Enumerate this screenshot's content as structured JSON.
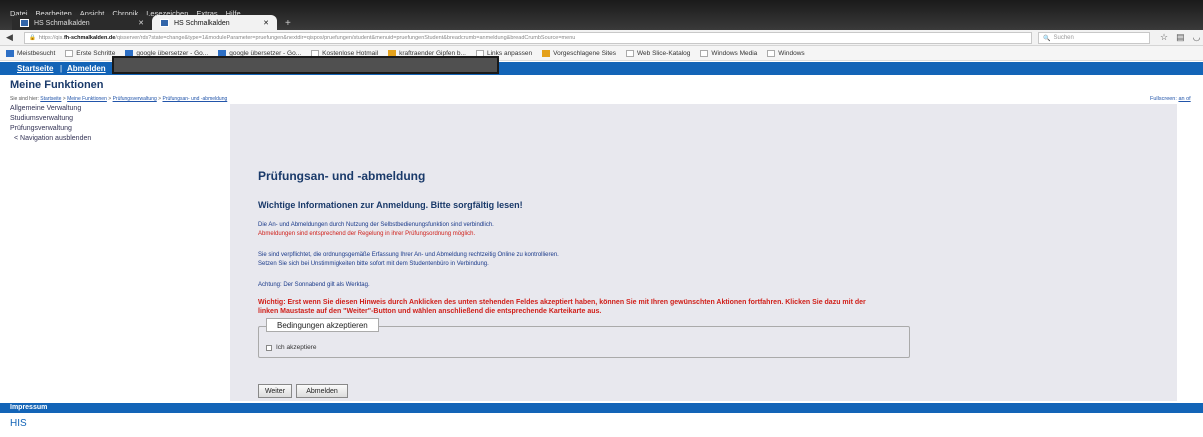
{
  "browser": {
    "menu": [
      "Datei",
      "Bearbeiten",
      "Ansicht",
      "Chronik",
      "Lesezeichen",
      "Extras",
      "Hilfe"
    ],
    "tabs": [
      {
        "label": "HS Schmalkalden",
        "active": false
      },
      {
        "label": "HS Schmalkalden",
        "active": true
      }
    ],
    "url_prefix": "https://qis.",
    "url_host": "fh-schmalkalden.de",
    "url_rest": "/qisserver/rds?state=change&type=1&moduleParameter=pruefungen&nextdir=qispos/pruefungen/student&menuid=pruefungenStudent&breadcrumb=anmeldung&breadCrumbSource=menu",
    "search_placeholder": "Suchen",
    "bookmarks": [
      "Meistbesucht",
      "Erste Schritte",
      "google übersetzer - Go...",
      "google übersetzer - Go...",
      "Kostenlose Hotmail",
      "kraftraender Gipfen b...",
      "Links anpassen",
      "Vorgeschlagene Sites",
      "Web Slice-Katalog",
      "Windows Media",
      "Windows"
    ]
  },
  "topbar": {
    "start": "Startseite",
    "sep": "|",
    "logout": "Abmelden"
  },
  "page": {
    "heading": "Meine Funktionen",
    "breadcrumb_prefix": "Sie sind hier:",
    "breadcrumb": [
      "Startseite",
      "Meine Funktionen",
      "Prüfungsverwaltung",
      "Prüfungsan- und -abmeldung"
    ],
    "fullscreen_label": "Fullscreen:",
    "fullscreen_link": "an of",
    "sidenav": [
      "Allgemeine Verwaltung",
      "Studiumsverwaltung",
      "Prüfungsverwaltung",
      "< Navigation ausblenden"
    ]
  },
  "main": {
    "title": "Prüfungsan- und -abmeldung",
    "subtitle": "Wichtige Informationen zur Anmeldung. Bitte sorgfältig lesen!",
    "line1": "Die An- und Abmeldungen durch Nutzung der Selbstbedienungsfunktion sind verbindlich.",
    "line2": "Abmeldungen sind entsprechend der Regelung in ihrer Prüfungsordnung möglich.",
    "line3": "Sie sind verpflichtet, die ordnungsgemäße Erfassung Ihrer An- und Abmeldung rechtzeitig Online zu kontrollieren.",
    "line4": "Setzen Sie sich bei Unstimmigkeiten bitte sofort mit dem Studentenbüro in Verbindung.",
    "line5": "Achtung: Der Sonnabend gilt als Werktag.",
    "warning": "Wichtig: Erst wenn Sie diesen Hinweis durch Anklicken des unten stehenden Feldes akzeptiert haben, können Sie mit Ihren gewünschten Aktionen fortfahren. Klicken Sie dazu mit der linken Maustaste auf den \"Weiter\"-Button und wählen anschließend die entsprechende Karteikarte aus.",
    "legend": "Bedingungen akzeptieren",
    "checkbox_label": "Ich akzeptiere",
    "btn_next": "Weiter",
    "btn_logout": "Abmelden"
  },
  "footer": {
    "impressum": "Impressum",
    "his": "HIS"
  }
}
